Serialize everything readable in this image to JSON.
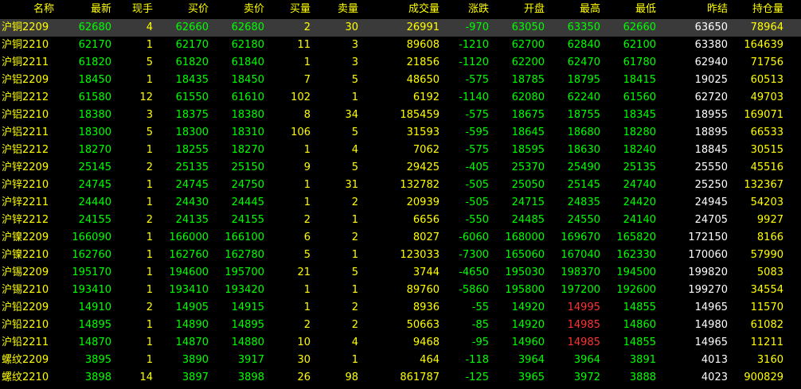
{
  "headers": {
    "name": "名称",
    "last": "最新",
    "volume_now": "现手",
    "bid": "买价",
    "ask": "卖价",
    "bid_vol": "买量",
    "ask_vol": "卖量",
    "total_vol": "成交量",
    "change": "涨跌",
    "open": "开盘",
    "high": "最高",
    "low": "最低",
    "prev_settle": "昨结",
    "open_interest": "持仓量"
  },
  "colors": {
    "up_text": "#ff3333",
    "down_text": "#00ff00",
    "volume_text": "#ffff00",
    "neutral_text": "#ffffff",
    "selected_row_bg": "#3a3a3a"
  },
  "rows": [
    {
      "name": "沪铜2209",
      "last": "62680",
      "vol": "4",
      "bid": "62660",
      "ask": "62680",
      "bidv": "2",
      "askv": "30",
      "total": "26991",
      "chg": "-970",
      "open": "63050",
      "high": "63350",
      "low": "62660",
      "pre": "63650",
      "oi": "78964",
      "high_up": false,
      "selected": true
    },
    {
      "name": "沪铜2210",
      "last": "62170",
      "vol": "1",
      "bid": "62170",
      "ask": "62180",
      "bidv": "11",
      "askv": "3",
      "total": "89608",
      "chg": "-1210",
      "open": "62700",
      "high": "62840",
      "low": "62100",
      "pre": "63380",
      "oi": "164639",
      "high_up": false,
      "selected": false
    },
    {
      "name": "沪铜2211",
      "last": "61820",
      "vol": "5",
      "bid": "61820",
      "ask": "61840",
      "bidv": "1",
      "askv": "3",
      "total": "21856",
      "chg": "-1120",
      "open": "62200",
      "high": "62470",
      "low": "61780",
      "pre": "62940",
      "oi": "71756",
      "high_up": false,
      "selected": false
    },
    {
      "name": "沪铝2209",
      "last": "18450",
      "vol": "1",
      "bid": "18435",
      "ask": "18450",
      "bidv": "7",
      "askv": "5",
      "total": "48650",
      "chg": "-575",
      "open": "18785",
      "high": "18795",
      "low": "18415",
      "pre": "19025",
      "oi": "60513",
      "high_up": false,
      "selected": false
    },
    {
      "name": "沪铜2212",
      "last": "61580",
      "vol": "12",
      "bid": "61550",
      "ask": "61610",
      "bidv": "102",
      "askv": "1",
      "total": "6192",
      "chg": "-1140",
      "open": "62080",
      "high": "62240",
      "low": "61560",
      "pre": "62720",
      "oi": "49703",
      "high_up": false,
      "selected": false
    },
    {
      "name": "沪铝2210",
      "last": "18380",
      "vol": "3",
      "bid": "18375",
      "ask": "18380",
      "bidv": "8",
      "askv": "34",
      "total": "185459",
      "chg": "-575",
      "open": "18675",
      "high": "18755",
      "low": "18345",
      "pre": "18955",
      "oi": "169071",
      "high_up": false,
      "selected": false
    },
    {
      "name": "沪铝2211",
      "last": "18300",
      "vol": "5",
      "bid": "18300",
      "ask": "18310",
      "bidv": "106",
      "askv": "5",
      "total": "31593",
      "chg": "-595",
      "open": "18645",
      "high": "18680",
      "low": "18280",
      "pre": "18895",
      "oi": "66533",
      "high_up": false,
      "selected": false
    },
    {
      "name": "沪铝2212",
      "last": "18270",
      "vol": "1",
      "bid": "18255",
      "ask": "18270",
      "bidv": "1",
      "askv": "4",
      "total": "7062",
      "chg": "-575",
      "open": "18595",
      "high": "18630",
      "low": "18240",
      "pre": "18845",
      "oi": "30515",
      "high_up": false,
      "selected": false
    },
    {
      "name": "沪锌2209",
      "last": "25145",
      "vol": "2",
      "bid": "25135",
      "ask": "25150",
      "bidv": "9",
      "askv": "5",
      "total": "29425",
      "chg": "-405",
      "open": "25370",
      "high": "25490",
      "low": "25135",
      "pre": "25550",
      "oi": "45516",
      "high_up": false,
      "selected": false
    },
    {
      "name": "沪锌2210",
      "last": "24745",
      "vol": "1",
      "bid": "24745",
      "ask": "24750",
      "bidv": "1",
      "askv": "31",
      "total": "132782",
      "chg": "-505",
      "open": "25050",
      "high": "25145",
      "low": "24740",
      "pre": "25250",
      "oi": "132367",
      "high_up": false,
      "selected": false
    },
    {
      "name": "沪锌2211",
      "last": "24440",
      "vol": "1",
      "bid": "24430",
      "ask": "24445",
      "bidv": "1",
      "askv": "2",
      "total": "20939",
      "chg": "-505",
      "open": "24715",
      "high": "24835",
      "low": "24420",
      "pre": "24945",
      "oi": "54203",
      "high_up": false,
      "selected": false
    },
    {
      "name": "沪锌2212",
      "last": "24155",
      "vol": "2",
      "bid": "24135",
      "ask": "24155",
      "bidv": "2",
      "askv": "1",
      "total": "6656",
      "chg": "-550",
      "open": "24485",
      "high": "24550",
      "low": "24140",
      "pre": "24705",
      "oi": "9927",
      "high_up": false,
      "selected": false
    },
    {
      "name": "沪镍2209",
      "last": "166090",
      "vol": "1",
      "bid": "166000",
      "ask": "166100",
      "bidv": "6",
      "askv": "2",
      "total": "8027",
      "chg": "-6060",
      "open": "168000",
      "high": "169670",
      "low": "165820",
      "pre": "172150",
      "oi": "8166",
      "high_up": false,
      "selected": false
    },
    {
      "name": "沪镍2210",
      "last": "162760",
      "vol": "1",
      "bid": "162760",
      "ask": "162780",
      "bidv": "5",
      "askv": "1",
      "total": "123033",
      "chg": "-7300",
      "open": "165060",
      "high": "167040",
      "low": "162330",
      "pre": "170060",
      "oi": "57990",
      "high_up": false,
      "selected": false
    },
    {
      "name": "沪锡2209",
      "last": "195170",
      "vol": "1",
      "bid": "194600",
      "ask": "195700",
      "bidv": "21",
      "askv": "5",
      "total": "3744",
      "chg": "-4650",
      "open": "195030",
      "high": "198370",
      "low": "194500",
      "pre": "199820",
      "oi": "5083",
      "high_up": false,
      "selected": false
    },
    {
      "name": "沪锡2210",
      "last": "193410",
      "vol": "1",
      "bid": "193410",
      "ask": "193420",
      "bidv": "1",
      "askv": "1",
      "total": "89760",
      "chg": "-5860",
      "open": "195800",
      "high": "197200",
      "low": "192600",
      "pre": "199270",
      "oi": "34554",
      "high_up": false,
      "selected": false
    },
    {
      "name": "沪铅2209",
      "last": "14910",
      "vol": "2",
      "bid": "14905",
      "ask": "14915",
      "bidv": "1",
      "askv": "2",
      "total": "8936",
      "chg": "-55",
      "open": "14920",
      "high": "14995",
      "low": "14855",
      "pre": "14965",
      "oi": "11570",
      "high_up": true,
      "selected": false
    },
    {
      "name": "沪铅2210",
      "last": "14895",
      "vol": "1",
      "bid": "14890",
      "ask": "14895",
      "bidv": "2",
      "askv": "2",
      "total": "50663",
      "chg": "-85",
      "open": "14920",
      "high": "14985",
      "low": "14860",
      "pre": "14980",
      "oi": "61082",
      "high_up": true,
      "selected": false
    },
    {
      "name": "沪铅2211",
      "last": "14870",
      "vol": "1",
      "bid": "14870",
      "ask": "14880",
      "bidv": "10",
      "askv": "4",
      "total": "9468",
      "chg": "-95",
      "open": "14960",
      "high": "14985",
      "low": "14855",
      "pre": "14965",
      "oi": "11211",
      "high_up": true,
      "selected": false
    },
    {
      "name": "螺纹2209",
      "last": "3895",
      "vol": "1",
      "bid": "3890",
      "ask": "3917",
      "bidv": "30",
      "askv": "1",
      "total": "464",
      "chg": "-118",
      "open": "3964",
      "high": "3964",
      "low": "3891",
      "pre": "4013",
      "oi": "3160",
      "high_up": false,
      "selected": false
    },
    {
      "name": "螺纹2210",
      "last": "3898",
      "vol": "14",
      "bid": "3897",
      "ask": "3898",
      "bidv": "26",
      "askv": "98",
      "total": "861787",
      "chg": "-125",
      "open": "3965",
      "high": "3972",
      "low": "3888",
      "pre": "4023",
      "oi": "900829",
      "high_up": false,
      "selected": false
    }
  ]
}
